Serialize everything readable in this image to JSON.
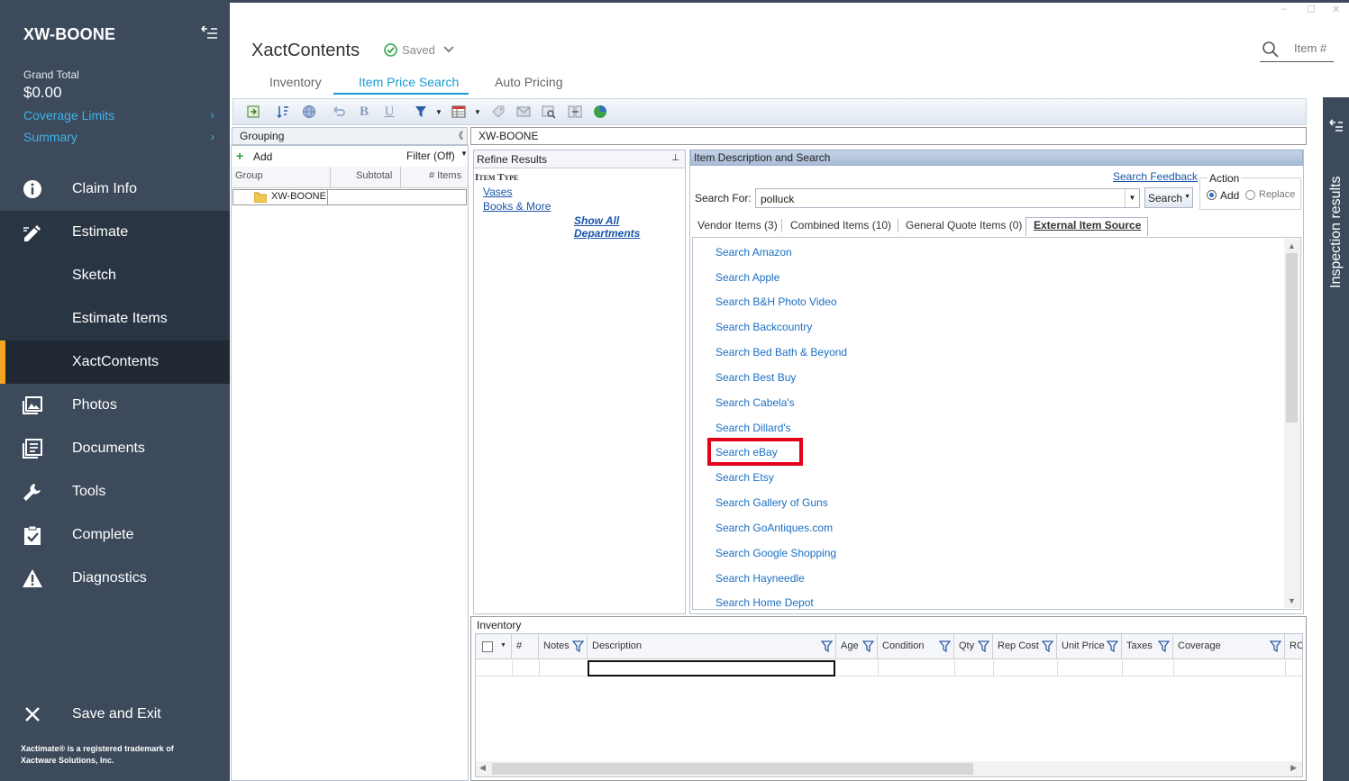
{
  "sidebar": {
    "title": "XW-BOONE",
    "grand_total_label": "Grand Total",
    "grand_total_value": "$0.00",
    "links": [
      {
        "label": "Coverage Limits",
        "chevron": "›"
      },
      {
        "label": "Summary",
        "chevron": "›"
      }
    ],
    "nav": [
      {
        "label": "Claim Info",
        "icon": "info-icon"
      },
      {
        "label": "Estimate",
        "icon": "pencil-icon"
      },
      {
        "label": "Sketch"
      },
      {
        "label": "Estimate Items"
      },
      {
        "label": "XactContents"
      },
      {
        "label": "Photos",
        "icon": "photos-icon"
      },
      {
        "label": "Documents",
        "icon": "documents-icon"
      },
      {
        "label": "Tools",
        "icon": "wrench-icon"
      },
      {
        "label": "Complete",
        "icon": "clipboard-check-icon"
      },
      {
        "label": "Diagnostics",
        "icon": "warning-icon"
      }
    ],
    "save_exit": "Save and Exit",
    "footer_line1": "Xactimate® is a registered trademark of",
    "footer_line2": "Xactware Solutions, Inc.",
    "accent_color": "#f5a623",
    "link_color": "#3fb3e8"
  },
  "header": {
    "app_title": "XactContents",
    "saved_label": "Saved",
    "search_placeholder": "Item #",
    "tabs": [
      {
        "label": "Inventory"
      },
      {
        "label": "Item Price Search",
        "active": true
      },
      {
        "label": "Auto Pricing"
      }
    ],
    "window_controls": [
      "–",
      "☐",
      "✕"
    ]
  },
  "grouping": {
    "header": "Grouping",
    "collapse": "《",
    "add_label": "Add",
    "filter_label": "Filter (Off)",
    "columns": [
      "Group",
      "Subtotal",
      "# Items"
    ],
    "rows": [
      {
        "group": "XW-BOONE"
      }
    ]
  },
  "claim_header": "XW-BOONE",
  "refine": {
    "header": "Refine Results",
    "pin": "⊥",
    "item_type_label": "Item Type",
    "items": [
      "Vases",
      "Books & More"
    ],
    "show_all": "Show All Departments"
  },
  "item_desc": {
    "header": "Item Description and Search",
    "feedback_link": "Search Feedback",
    "search_for_label": "Search For:",
    "search_value": "polluck",
    "search_button": "Search",
    "action_label": "Action",
    "action_add": "Add",
    "action_replace": "Replace",
    "subtabs": [
      {
        "label": "Vendor Items (3)"
      },
      {
        "label": "Combined Items (10)"
      },
      {
        "label": "General Quote Items (0)"
      },
      {
        "label": "External Item Source",
        "active": true
      }
    ],
    "external_sources": [
      "Search Amazon",
      "Search Apple",
      "Search B&H Photo Video",
      "Search Backcountry",
      "Search Bed Bath & Beyond",
      "Search Best Buy",
      "Search Cabela's",
      "Search Dillard's",
      "Search eBay",
      "Search Etsy",
      "Search Gallery of Guns",
      "Search GoAntiques.com",
      "Search Google Shopping",
      "Search Hayneedle",
      "Search Home Depot"
    ],
    "highlight_color": "#e2001a"
  },
  "inventory": {
    "header": "Inventory",
    "columns": [
      "#",
      "Notes",
      "Description",
      "Age",
      "Condition",
      "Qty",
      "Rep Cost",
      "Unit Price",
      "Taxes",
      "Coverage",
      "RC"
    ]
  },
  "rail": {
    "label": "Inspection results"
  }
}
